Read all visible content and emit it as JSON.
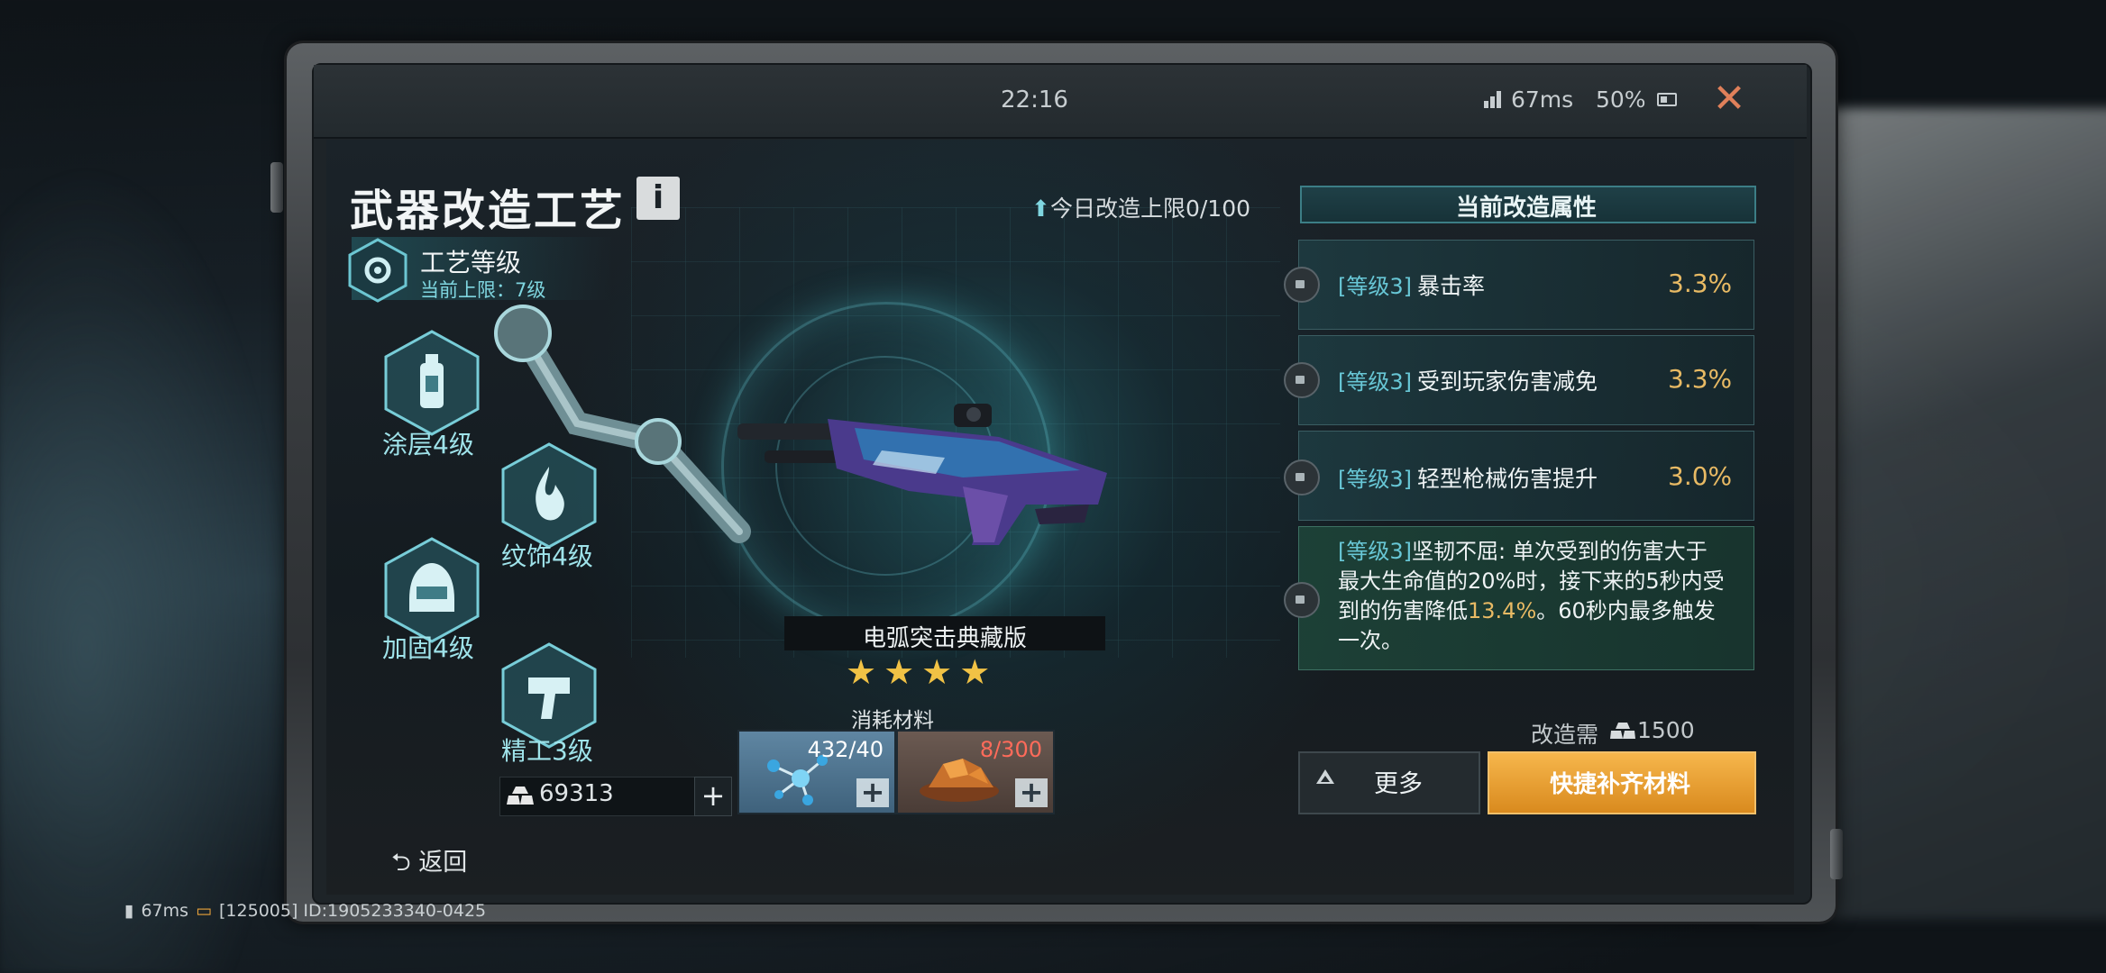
{
  "status_bar": {
    "time": "22:16",
    "ping": "67ms",
    "battery": "50%"
  },
  "header": {
    "title": "武器改造工艺",
    "info_label": "i"
  },
  "craft": {
    "label": "工艺等级",
    "limit": "当前上限：7级"
  },
  "categories": [
    {
      "label": "涂层4级",
      "icon": "spray-can-icon"
    },
    {
      "label": "纹饰4级",
      "icon": "flame-icon"
    },
    {
      "label": "加固4级",
      "icon": "helmet-icon"
    },
    {
      "label": "精工3级",
      "icon": "drill-icon"
    }
  ],
  "currency": {
    "value": "69313",
    "plus": "+"
  },
  "back_label": "返回",
  "daily_limit": "今日改造上限0/100",
  "weapon": {
    "name": "电弧突击典藏版",
    "stars": "★★★★",
    "star_count": 4
  },
  "materials": {
    "label": "消耗材料",
    "items": [
      {
        "count": "432/40",
        "color": "#ffffff",
        "icon": "molecule-icon"
      },
      {
        "count": "8/300",
        "color": "#ff6b5a",
        "icon": "gold-ore-icon"
      }
    ]
  },
  "attributes": {
    "header": "当前改造属性",
    "rows": [
      {
        "level": "[等级3]",
        "name": "暴击率",
        "value": "3.3%"
      },
      {
        "level": "[等级3]",
        "name": "受到玩家伤害减免",
        "value": "3.3%"
      },
      {
        "level": "[等级3]",
        "name": "轻型枪械伤害提升",
        "value": "3.0%"
      }
    ],
    "long": {
      "level": "[等级3]",
      "text1": "坚韧不屈: 单次受到的伤害大于最大生命值的20%时，接下来的5秒内受到的伤害降低",
      "highlight": "13.4%",
      "text2": "。60秒内最多触发一次。"
    }
  },
  "cost": {
    "label": "改造需",
    "value": "1500"
  },
  "buttons": {
    "more": "更多",
    "quick": "快捷补齐材料"
  },
  "bottom_status": {
    "ping": "67ms",
    "id": "[125005] ID:1905233340-0425"
  },
  "colors": {
    "accent": "#68c7d6",
    "value": "#e8ba64",
    "primary_button": "#f0a83c"
  }
}
